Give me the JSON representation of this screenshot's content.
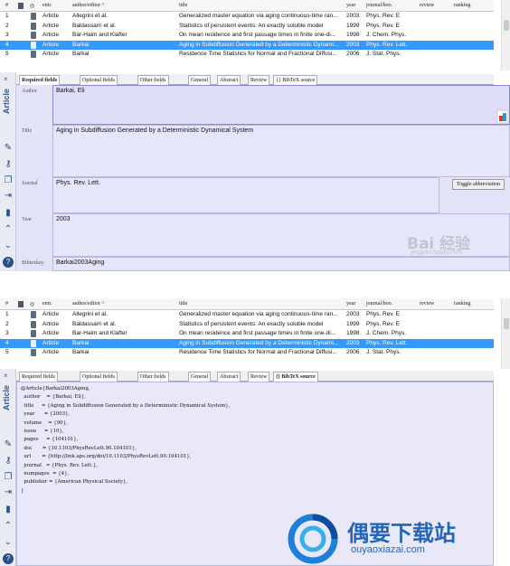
{
  "columns": {
    "num": "#",
    "entry": "entr.",
    "author": "author/editor ^",
    "title": "title",
    "year": "year",
    "journal": "journal/boo.",
    "review": "review",
    "ranking": "ranking"
  },
  "rows": [
    {
      "n": "1",
      "type": "Article",
      "author": "Allegrini et al.",
      "title": "Generalized master equation via aging continuous-time ran...",
      "year": "2003",
      "journal": "Phys. Rev. E"
    },
    {
      "n": "2",
      "type": "Article",
      "author": "Baldassarri et al.",
      "title": "Statistics of persistent events: An exactly soluble model",
      "year": "1999",
      "journal": "Phys. Rev. E"
    },
    {
      "n": "3",
      "type": "Article",
      "author": "Bar-Haim and Klafter",
      "title": "On mean residence and first passage times in finite one-di...",
      "year": "1998",
      "journal": "J. Chem. Phys."
    },
    {
      "n": "4",
      "type": "Article",
      "author": "Barkai",
      "title": "Aging in Subdiffusion Generated by a Deterministic Dynami...",
      "year": "2003",
      "journal": "Phys. Rev. Lett."
    },
    {
      "n": "5",
      "type": "Article",
      "author": "Barkai",
      "title": "Residence Time Statistics for Normal and Fractional Diffusi...",
      "year": "2006",
      "journal": "J. Stat. Phys."
    }
  ],
  "selected_row": "4",
  "sidebar": {
    "label": "Article",
    "close": "×"
  },
  "tabs": [
    {
      "label": "Required fields"
    },
    {
      "label": "Optional fields"
    },
    {
      "label": "Other fields"
    },
    {
      "label": "General"
    },
    {
      "label": "Abstract"
    },
    {
      "label": "Review"
    },
    {
      "label": "{} BibTeX source"
    }
  ],
  "fields": {
    "author": {
      "label": "Author",
      "value": "Barkai, Eli"
    },
    "title": {
      "label": "Title",
      "value": "Aging in Subdiffusion Generated by a Deterministic Dynamical System"
    },
    "journal": {
      "label": "Journal",
      "value": "Phys. Rev. Lett.",
      "button": "Toggle abbreviation"
    },
    "year": {
      "label": "Year",
      "value": "2003"
    },
    "bibtexkey": {
      "label": "Bibtexkey",
      "value": "Barkai2003Aging"
    }
  },
  "bibtex_lines": [
    "@Article{Barkai2003Aging,",
    "  author    = {Barkai, Eli},",
    "  title     = {Aging in Subdiffusion Generated by a Deterministic Dynamical System},",
    "  year      = {2003},",
    "  volume    = {90},",
    "  issue     = {10},",
    "  pages     = {104101},",
    "  doi       = {10.1103/PhysRevLett.90.104101},",
    "  url       = {http://link.aps.org/doi/10.1103/PhysRevLett.90.104101},",
    "  journal   = {Phys. Rev. Lett.},",
    "  numpages  = {4},",
    "  publisher = {American Physical Society},",
    "}"
  ],
  "watermarks": {
    "baidu": "Bai 经验",
    "baidu_sub": "jingyan.baidu.com",
    "site": "偶要下载站",
    "site_url": "ouyaoxiazai.com"
  },
  "colors": {
    "selection": "#3399ff",
    "field_bg": "#e6e6fa",
    "brand_blue": "#2366b8"
  }
}
